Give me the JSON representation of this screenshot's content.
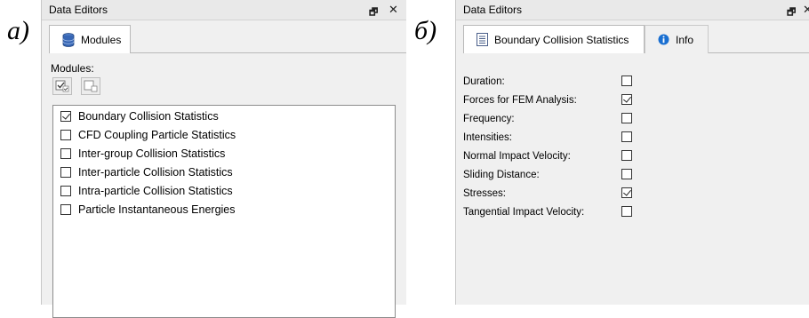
{
  "figure_labels": {
    "left": "а)",
    "right": "б)"
  },
  "left_panel": {
    "title": "Data Editors",
    "pin_glyph": "🗗",
    "close_glyph": "✕",
    "tab": {
      "label": "Modules",
      "icon": "database-icon"
    },
    "modules_label": "Modules:",
    "toolbar": [
      {
        "name": "select-all-button",
        "icon": "check-all-icon"
      },
      {
        "name": "deselect-all-button",
        "icon": "uncheck-all-icon"
      }
    ],
    "modules": [
      {
        "label": "Boundary Collision Statistics",
        "checked": true
      },
      {
        "label": "CFD Coupling Particle Statistics",
        "checked": false
      },
      {
        "label": "Inter-group Collision Statistics",
        "checked": false
      },
      {
        "label": "Inter-particle Collision Statistics",
        "checked": false
      },
      {
        "label": "Intra-particle Collision Statistics",
        "checked": false
      },
      {
        "label": "Particle Instantaneous Energies",
        "checked": false
      }
    ]
  },
  "right_panel": {
    "title": "Data Editors",
    "pin_glyph": "🗗",
    "close_glyph": "✕",
    "tabs": [
      {
        "label": "Boundary Collision Statistics",
        "icon": "document-icon",
        "active": true
      },
      {
        "label": "Info",
        "icon": "info-icon",
        "active": false
      }
    ],
    "properties": [
      {
        "label": "Duration:",
        "checked": false
      },
      {
        "label": "Forces for FEM Analysis:",
        "checked": true
      },
      {
        "label": "Frequency:",
        "checked": false
      },
      {
        "label": "Intensities:",
        "checked": false
      },
      {
        "label": "Normal Impact Velocity:",
        "checked": false
      },
      {
        "label": "Sliding Distance:",
        "checked": false
      },
      {
        "label": "Stresses:",
        "checked": true
      },
      {
        "label": "Tangential Impact Velocity:",
        "checked": false
      }
    ]
  }
}
